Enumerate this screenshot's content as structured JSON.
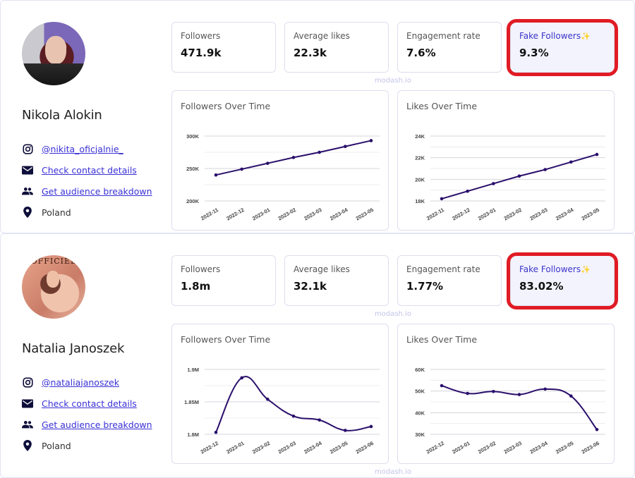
{
  "watermark": "modash.io",
  "profiles": [
    {
      "name": "Nikola Alokin",
      "avatar": "profile-photo",
      "instagram_handle": "@nikita_oficjalnie_",
      "contact_link": "Check contact details",
      "audience_link": "Get audience breakdown",
      "location": "Poland",
      "stats": [
        {
          "label": "Followers",
          "value": "471.9k"
        },
        {
          "label": "Average likes",
          "value": "22.3k"
        },
        {
          "label": "Engagement rate",
          "value": "7.6%"
        },
        {
          "label": "Fake Followers",
          "value": "9.3%",
          "icon": "sparkles-icon",
          "highlighted": true
        }
      ],
      "icons": {
        "instagram": "instagram-icon",
        "contact": "mail-icon",
        "audience": "people-icon",
        "location": "location-pin-icon"
      }
    },
    {
      "name": "Natalia Janoszek",
      "avatar": "profile-photo",
      "avatar_magazine_text": "OFFICIEL",
      "instagram_handle": "@nataliajanoszek",
      "contact_link": "Check contact details",
      "audience_link": "Get audience breakdown",
      "location": "Poland",
      "stats": [
        {
          "label": "Followers",
          "value": "1.8m"
        },
        {
          "label": "Average likes",
          "value": "32.1k"
        },
        {
          "label": "Engagement rate",
          "value": "1.77%"
        },
        {
          "label": "Fake Followers",
          "value": "83.02%",
          "icon": "sparkles-icon",
          "highlighted": true
        }
      ],
      "icons": {
        "instagram": "instagram-icon",
        "contact": "mail-icon",
        "audience": "people-icon",
        "location": "location-pin-icon"
      }
    }
  ],
  "colors": {
    "accent_link": "#3a31d6",
    "line": "#2a0f6b",
    "highlight_border": "#e01b24",
    "fake_card_bg": "#f3f3fd",
    "sparkle": "#f4c542"
  },
  "chart_data": [
    {
      "type": "line",
      "title": "Followers Over Time",
      "profile": "Nikola Alokin",
      "categories": [
        "2022-11",
        "2022-12",
        "2023-01",
        "2023-02",
        "2023-03",
        "2023-04",
        "2023-05"
      ],
      "values": [
        240000,
        249000,
        258000,
        267000,
        275000,
        284000,
        293000
      ],
      "yticks": [
        200000,
        250000,
        300000
      ],
      "ytick_labels": [
        "200K",
        "250K",
        "300K"
      ],
      "ylim": [
        200000,
        300000
      ],
      "xlabel": "",
      "ylabel": "",
      "grid": true,
      "legend": "none",
      "smooth": false
    },
    {
      "type": "line",
      "title": "Likes Over Time",
      "profile": "Nikola Alokin",
      "categories": [
        "2022-11",
        "2022-12",
        "2023-01",
        "2023-02",
        "2023-03",
        "2023-04",
        "2023-05"
      ],
      "values": [
        18200,
        18900,
        19600,
        20300,
        20900,
        21600,
        22300
      ],
      "yticks": [
        18000,
        20000,
        22000,
        24000
      ],
      "ytick_labels": [
        "18K",
        "20K",
        "22K",
        "24K"
      ],
      "ylim": [
        18000,
        24000
      ],
      "xlabel": "",
      "ylabel": "",
      "grid": true,
      "legend": "none",
      "smooth": false
    },
    {
      "type": "line",
      "title": "Followers Over Time",
      "profile": "Natalia Janoszek",
      "categories": [
        "2022-12",
        "2023-01",
        "2023-02",
        "2023-03",
        "2023-04",
        "2023-05",
        "2023-06"
      ],
      "values": [
        1803000,
        1887000,
        1854000,
        1828000,
        1822000,
        1806000,
        1812000
      ],
      "yticks": [
        1800000,
        1850000,
        1900000
      ],
      "ytick_labels": [
        "1.8M",
        "1.85M",
        "1.9M"
      ],
      "ylim": [
        1800000,
        1900000
      ],
      "xlabel": "",
      "ylabel": "",
      "grid": true,
      "legend": "none",
      "smooth": true
    },
    {
      "type": "line",
      "title": "Likes Over Time",
      "profile": "Natalia Janoszek",
      "categories": [
        "2022-12",
        "2023-01",
        "2023-02",
        "2023-03",
        "2023-04",
        "2023-05",
        "2023-06"
      ],
      "values": [
        52500,
        48900,
        49800,
        48400,
        50900,
        47700,
        32200
      ],
      "yticks": [
        30000,
        40000,
        50000,
        60000
      ],
      "ytick_labels": [
        "30K",
        "40K",
        "50K",
        "60K"
      ],
      "ylim": [
        30000,
        60000
      ],
      "xlabel": "",
      "ylabel": "",
      "grid": true,
      "legend": "none",
      "smooth": true
    }
  ]
}
